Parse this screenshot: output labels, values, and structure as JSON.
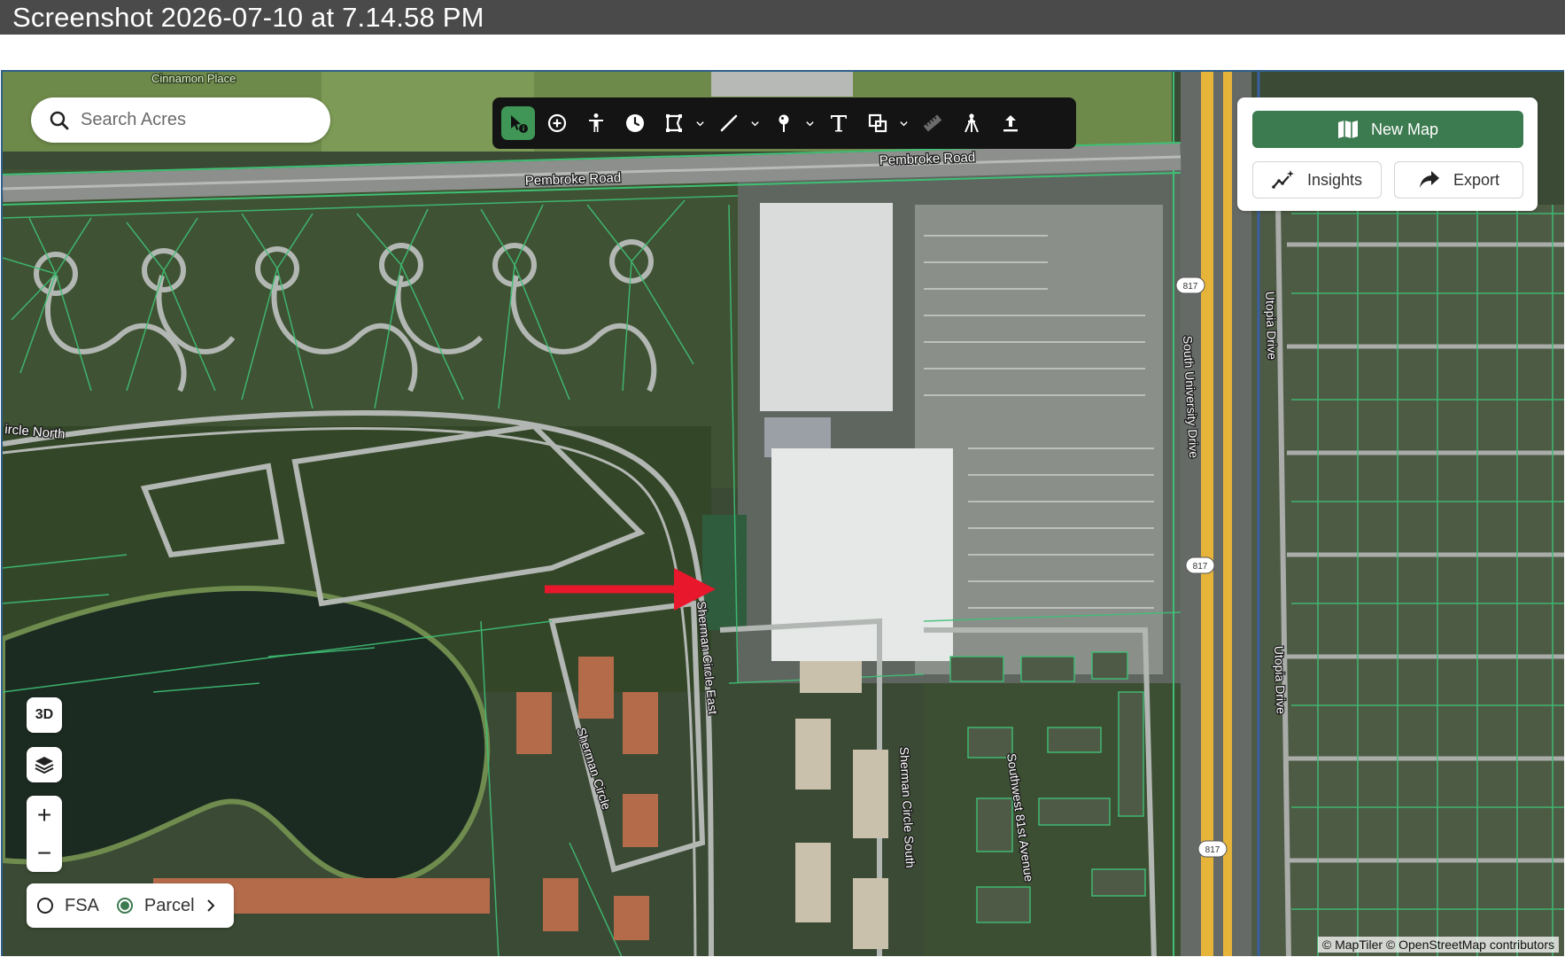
{
  "window": {
    "title": "Screenshot 2026-07-10 at 7.14.58  PM"
  },
  "search": {
    "placeholder": "Search Acres",
    "icon": "search-icon"
  },
  "toolbar": {
    "tools": [
      {
        "name": "select-tool",
        "icon": "cursor-info-icon",
        "active": true
      },
      {
        "name": "add-point-tool",
        "icon": "plus-circle-icon"
      },
      {
        "name": "accessibility-tool",
        "icon": "person-icon"
      },
      {
        "name": "history-tool",
        "icon": "clock-icon"
      },
      {
        "name": "polygon-tool",
        "icon": "polygon-icon",
        "dropdown": true
      },
      {
        "name": "line-tool",
        "icon": "line-icon",
        "dropdown": true
      },
      {
        "name": "pin-tool",
        "icon": "pin-icon",
        "dropdown": true
      },
      {
        "name": "text-tool",
        "icon": "text-icon"
      },
      {
        "name": "shapes-tool",
        "icon": "shapes-icon",
        "dropdown": true
      },
      {
        "name": "measure-tool",
        "icon": "ruler-icon"
      },
      {
        "name": "survey-tool",
        "icon": "compass-icon"
      },
      {
        "name": "upload-tool",
        "icon": "upload-icon"
      }
    ]
  },
  "panel": {
    "new_map": "New Map",
    "insights": "Insights",
    "export": "Export",
    "accent": "#3c7a4f"
  },
  "controls": {
    "three_d": "3D",
    "layers_icon": "layers-icon",
    "zoom_in": "+",
    "zoom_out": "−"
  },
  "legend": {
    "fsa": "FSA",
    "parcel": "Parcel",
    "selected": "Parcel"
  },
  "map": {
    "labels": {
      "cinnamon": "Cinnamon Place",
      "pembroke1": "Pembroke Road",
      "pembroke2": "Pembroke Road",
      "circle_north": "ircle North",
      "sherman_east": "Sherman Circle East",
      "sherman_circle": "Sherman Circle",
      "sherman_south": "Sherman Circle South",
      "sw81": "Southwest 81st Avenue",
      "university": "South University Drive",
      "utopia1": "Utopia Drive",
      "utopia2": "Utopia Drive"
    },
    "shields": [
      "817",
      "817",
      "817"
    ],
    "parcel_color": "#3fbf75",
    "arrow_color": "#e8172c"
  },
  "attribution": "© MapTiler © OpenStreetMap contributors"
}
